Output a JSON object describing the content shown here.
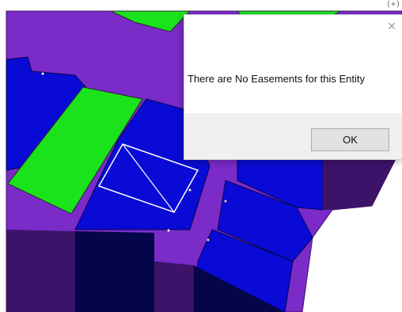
{
  "colors": {
    "purple": "#7a2bc8",
    "dark_purple": "#3d1369",
    "blue": "#0a0ad6",
    "dark_blue": "#05054a",
    "green": "#1be31b",
    "dialog_footer": "#f0f0f0",
    "button": "#e1e1e1"
  },
  "dialog": {
    "message": "There are No Easements for this Entity",
    "ok_label": "OK",
    "close_icon": "close-icon"
  },
  "corner_glyph": "(+)"
}
